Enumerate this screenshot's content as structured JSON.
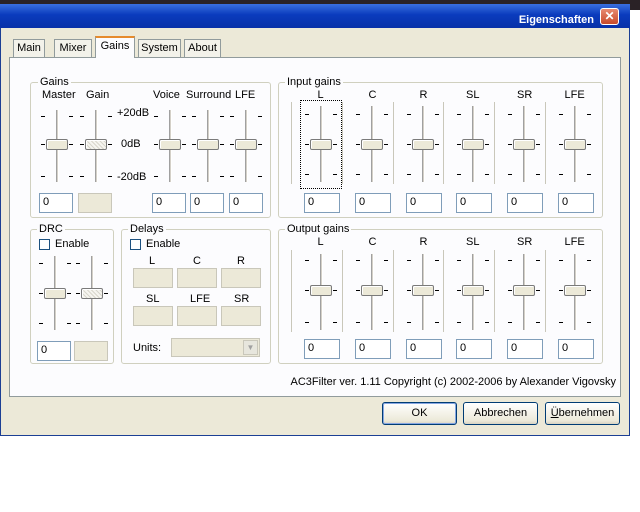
{
  "window": {
    "title": "Eigenschaften",
    "close_glyph": "✕"
  },
  "tabs": [
    {
      "label": "Main"
    },
    {
      "label": "Mixer"
    },
    {
      "label": "Gains",
      "active": true
    },
    {
      "label": "System"
    },
    {
      "label": "About"
    }
  ],
  "gains": {
    "title": "Gains",
    "col_labels": {
      "master": "Master",
      "gain": "Gain",
      "voice": "Voice",
      "surround": "Surround",
      "lfe": "LFE"
    },
    "scale_labels": {
      "top": "+20dB",
      "mid": "0dB",
      "bottom": "-20dB"
    },
    "values": {
      "master": "0",
      "gain": "",
      "voice": "0",
      "surround": "0",
      "lfe": "0"
    }
  },
  "input_gains": {
    "title": "Input gains",
    "channels": [
      {
        "label": "L",
        "value": "0"
      },
      {
        "label": "C",
        "value": "0"
      },
      {
        "label": "R",
        "value": "0"
      },
      {
        "label": "SL",
        "value": "0"
      },
      {
        "label": "SR",
        "value": "0"
      },
      {
        "label": "LFE",
        "value": "0"
      }
    ]
  },
  "output_gains": {
    "title": "Output gains",
    "channels": [
      {
        "label": "L",
        "value": "0"
      },
      {
        "label": "C",
        "value": "0"
      },
      {
        "label": "R",
        "value": "0"
      },
      {
        "label": "SL",
        "value": "0"
      },
      {
        "label": "SR",
        "value": "0"
      },
      {
        "label": "LFE",
        "value": "0"
      }
    ]
  },
  "drc": {
    "title": "DRC",
    "enable_label": "Enable",
    "value": "0",
    "value2": ""
  },
  "delays": {
    "title": "Delays",
    "enable_label": "Enable",
    "labels_row1": [
      "L",
      "C",
      "R"
    ],
    "labels_row2": [
      "SL",
      "LFE",
      "SR"
    ],
    "units_label": "Units:",
    "units_value": ""
  },
  "copyright": "AC3Filter ver. 1.11 Copyright (c) 2002-2006 by Alexander Vigovsky",
  "buttons": {
    "ok": "OK",
    "cancel": "Abbrechen",
    "apply_prefix": "Ü",
    "apply_rest": "bernehmen"
  }
}
